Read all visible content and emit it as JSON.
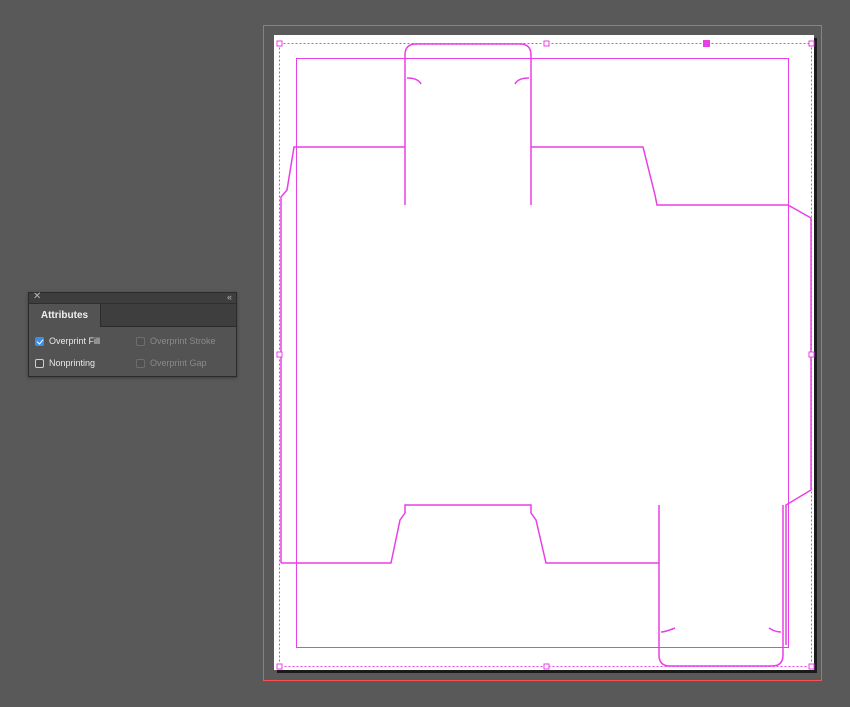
{
  "panel": {
    "tab_label": "Attributes",
    "close_icon": "close-icon",
    "collapse_icon": "double-chevron-icon",
    "options": [
      {
        "label": "Overprint Fill",
        "checked": true,
        "enabled": true
      },
      {
        "label": "Overprint Stroke",
        "checked": false,
        "enabled": false
      },
      {
        "label": "Nonprinting",
        "checked": false,
        "enabled": true
      },
      {
        "label": "Overprint Gap",
        "checked": false,
        "enabled": false
      }
    ]
  },
  "colors": {
    "canvas_background": "#595959",
    "artboard": "#ffffff",
    "dieline": "#e83fe8",
    "bleed_guide": "#ff5050",
    "checkbox_accent": "#3d8ee8"
  }
}
